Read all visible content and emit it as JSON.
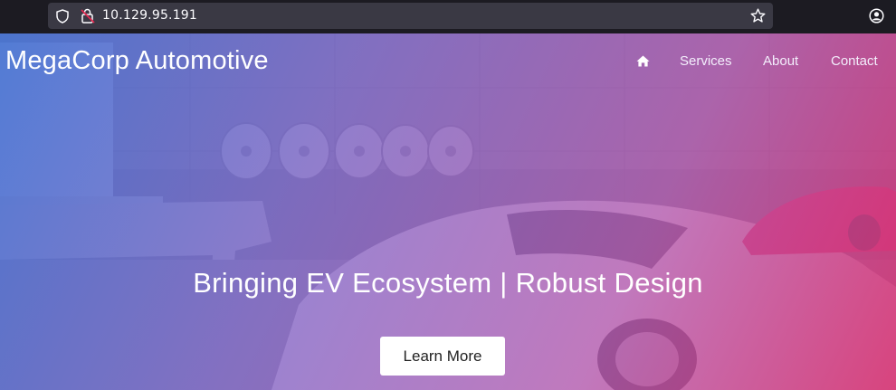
{
  "browser": {
    "url": "10.129.95.191",
    "icons": [
      "shield-icon",
      "insecure-lock-icon",
      "bookmark-star-icon",
      "account-icon"
    ]
  },
  "site": {
    "brand": "MegaCorp Automotive",
    "nav": {
      "home_icon": "home-icon",
      "items": [
        "Services",
        "About",
        "Contact"
      ]
    },
    "hero": {
      "headline": "Bringing EV Ecosystem | Robust Design",
      "cta_label": "Learn More"
    }
  },
  "colors": {
    "gradient_start": "#3e6ed2",
    "gradient_end": "#d62e6e",
    "text": "#ffffff"
  }
}
